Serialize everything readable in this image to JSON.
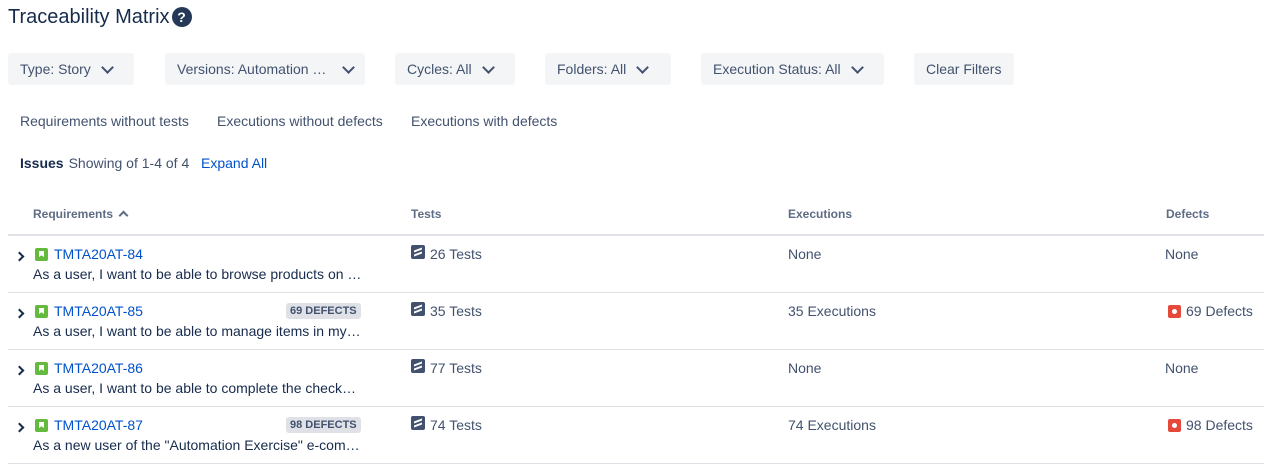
{
  "page": {
    "title": "Traceability Matrix",
    "help_icon": "help-icon",
    "help_glyph": "?"
  },
  "filters": {
    "type": "Type: Story",
    "versions": "Versions: Automation Exercise",
    "cycles": "Cycles: All",
    "folders": "Folders: All",
    "execution_status": "Execution Status: All",
    "clear": "Clear Filters"
  },
  "quick_filters": [
    "Requirements without tests",
    "Executions without defects",
    "Executions with defects"
  ],
  "issues": {
    "label": "Issues",
    "showing": "Showing of 1-4 of 4",
    "expand_all": "Expand All"
  },
  "columns": {
    "requirements": "Requirements",
    "tests": "Tests",
    "executions": "Executions",
    "defects": "Defects"
  },
  "rows": [
    {
      "key": "TMTA20AT-84",
      "badge": "",
      "summary": "As a user, I want to be able to browse products on the website",
      "tests": "26 Tests",
      "executions": "None",
      "defects": "None"
    },
    {
      "key": "TMTA20AT-85",
      "badge": "69 DEFECTS",
      "summary": "As a user, I want to be able to manage items in my cart",
      "tests": "35 Tests",
      "executions": "35 Executions",
      "defects": "69 Defects"
    },
    {
      "key": "TMTA20AT-86",
      "badge": "",
      "summary": "As a user, I want to be able to complete the checkout process",
      "tests": "77 Tests",
      "executions": "None",
      "defects": "None"
    },
    {
      "key": "TMTA20AT-87",
      "badge": "98 DEFECTS",
      "summary": "As a new user of the \"Automation Exercise\" e-commerce website",
      "tests": "74 Tests",
      "executions": "74 Executions",
      "defects": "98 Defects"
    }
  ],
  "colors": {
    "link": "#0052cc",
    "story": "#63ba3c",
    "defect": "#e5493a",
    "filter_bg": "#f4f5f7"
  }
}
